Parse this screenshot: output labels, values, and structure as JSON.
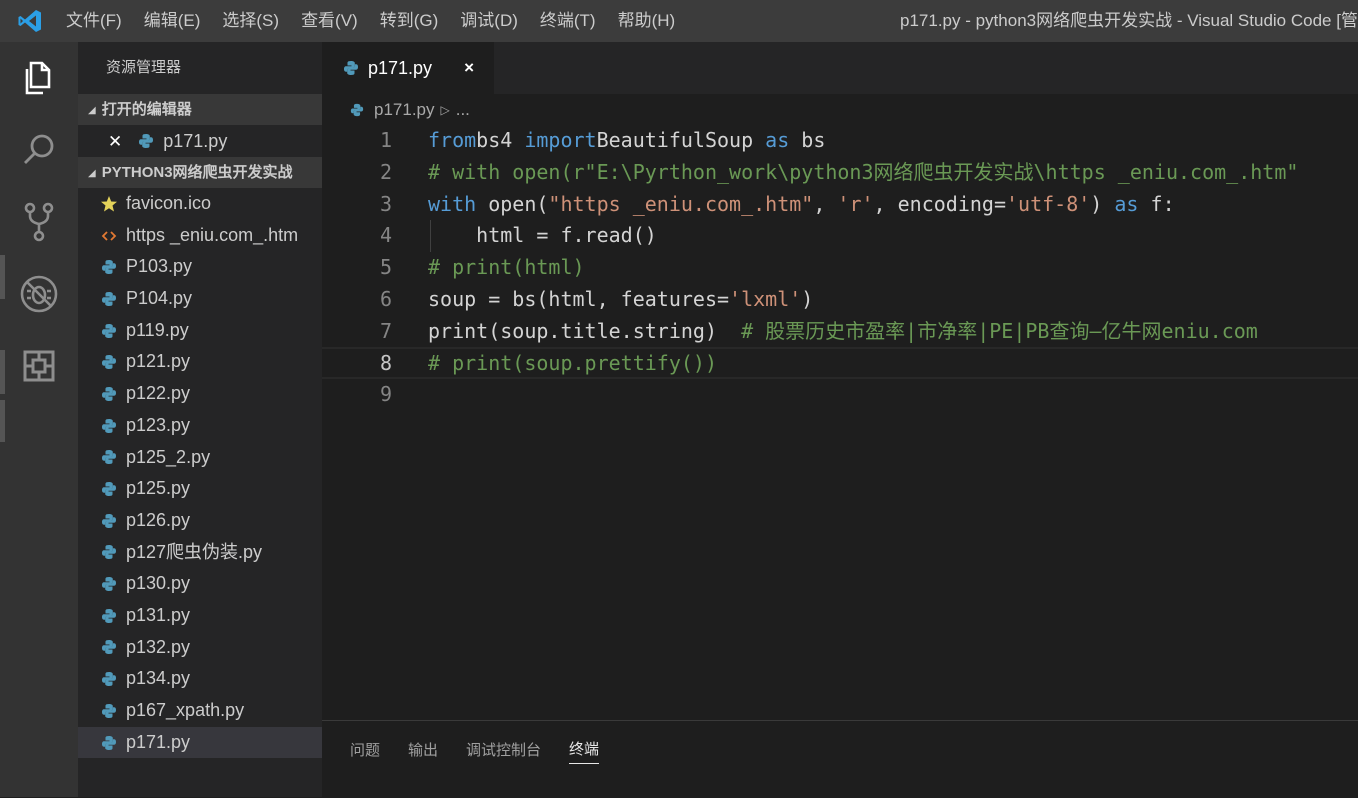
{
  "titlebar": {
    "menus": [
      "文件(F)",
      "编辑(E)",
      "选择(S)",
      "查看(V)",
      "转到(G)",
      "调试(D)",
      "终端(T)",
      "帮助(H)"
    ],
    "window_title": "p171.py - python3网络爬虫开发实战 - Visual Studio Code [管"
  },
  "activity_bar": {
    "icons": [
      "files-icon",
      "search-icon",
      "source-control-icon",
      "debug-icon",
      "extensions-icon"
    ]
  },
  "sidebar": {
    "title": "资源管理器",
    "open_editors_header": "打开的编辑器",
    "open_editors": [
      {
        "label": "p171.py"
      }
    ],
    "folder_header": "PYTHON3网络爬虫开发实战",
    "files": [
      {
        "label": "favicon.ico",
        "icon": "star-icon"
      },
      {
        "label": "https _eniu.com_.htm",
        "icon": "html-icon"
      },
      {
        "label": "P103.py",
        "icon": "python-icon"
      },
      {
        "label": "P104.py",
        "icon": "python-icon"
      },
      {
        "label": "p119.py",
        "icon": "python-icon"
      },
      {
        "label": "p121.py",
        "icon": "python-icon"
      },
      {
        "label": "p122.py",
        "icon": "python-icon"
      },
      {
        "label": "p123.py",
        "icon": "python-icon"
      },
      {
        "label": "p125_2.py",
        "icon": "python-icon"
      },
      {
        "label": "p125.py",
        "icon": "python-icon"
      },
      {
        "label": "p126.py",
        "icon": "python-icon"
      },
      {
        "label": "p127爬虫伪装.py",
        "icon": "python-icon"
      },
      {
        "label": "p130.py",
        "icon": "python-icon"
      },
      {
        "label": "p131.py",
        "icon": "python-icon"
      },
      {
        "label": "p132.py",
        "icon": "python-icon"
      },
      {
        "label": "p134.py",
        "icon": "python-icon"
      },
      {
        "label": "p167_xpath.py",
        "icon": "python-icon"
      },
      {
        "label": "p171.py",
        "icon": "python-icon",
        "selected": true
      }
    ]
  },
  "editor": {
    "tab_label": "p171.py",
    "tab_close": "×",
    "breadcrumb_file": "p171.py",
    "breadcrumb_more": "...",
    "lines": [
      {
        "n": "1",
        "tokens": [
          [
            "kw",
            "from"
          ],
          [
            "",
            "bs4 "
          ],
          [
            "kw",
            "import"
          ],
          [
            "",
            "BeautifulSoup "
          ],
          [
            "kw",
            "as"
          ],
          [
            "",
            " bs"
          ]
        ]
      },
      {
        "n": "2",
        "tokens": [
          [
            "cm",
            "# with open(r\"E:\\Pyrthon_work\\python3网络爬虫开发实战\\https _eniu.com_.htm\""
          ]
        ]
      },
      {
        "n": "3",
        "tokens": [
          [
            "kw",
            "with"
          ],
          [
            "",
            " open("
          ],
          [
            "st",
            "\"https _eniu.com_.htm\""
          ],
          [
            "",
            ", "
          ],
          [
            "st",
            "'r'"
          ],
          [
            "",
            ", encoding="
          ],
          [
            "st",
            "'utf-8'"
          ],
          [
            "",
            ") "
          ],
          [
            "kw",
            "as"
          ],
          [
            "",
            " f:"
          ]
        ]
      },
      {
        "n": "4",
        "tokens": [
          [
            "",
            "    html = f.read()"
          ]
        ]
      },
      {
        "n": "5",
        "tokens": [
          [
            "cm",
            "# print(html)"
          ]
        ]
      },
      {
        "n": "6",
        "tokens": [
          [
            "",
            "soup = bs(html, features="
          ],
          [
            "st",
            "'lxml'"
          ],
          [
            "",
            ")"
          ]
        ]
      },
      {
        "n": "7",
        "tokens": [
          [
            "",
            "print(soup.title.string)  "
          ],
          [
            "cm",
            "# 股票历史市盈率|市净率|PE|PB查询—亿牛网eniu.com"
          ]
        ]
      },
      {
        "n": "8",
        "tokens": [
          [
            "cm",
            "# print(soup.prettify())"
          ]
        ],
        "current": true
      },
      {
        "n": "9",
        "tokens": []
      }
    ]
  },
  "panel": {
    "tabs": [
      "问题",
      "输出",
      "调试控制台",
      "终端"
    ],
    "active_tab": "终端"
  }
}
